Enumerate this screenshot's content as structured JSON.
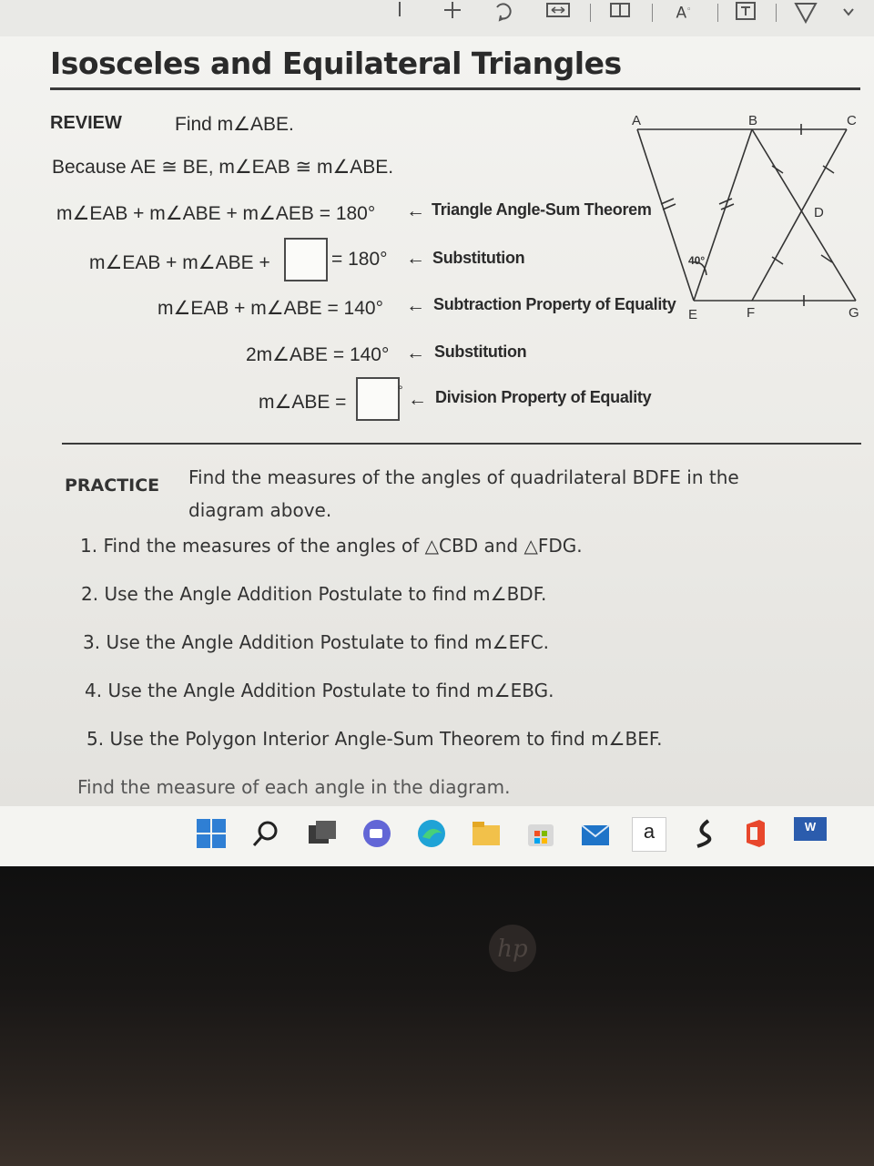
{
  "toolbar": {
    "icons": [
      "minus-icon",
      "plus-icon",
      "rotate-icon",
      "fit-width-icon",
      "immersive-reader-icon",
      "text-size-icon",
      "text-box-icon",
      "draw-icon",
      "chevron-down-icon"
    ],
    "text_size_label": "A"
  },
  "page": {
    "title": "Isosceles and Equilateral Triangles"
  },
  "review": {
    "label": "REVIEW",
    "prompt": "Find m∠ABE.",
    "because": "Because AE ≅ BE, m∠EAB ≅ m∠ABE.",
    "lines": [
      {
        "expr": "m∠EAB + m∠ABE + m∠AEB = 180°",
        "arrow": "←",
        "reason": "Triangle Angle-Sum Theorem"
      },
      {
        "expr_before": "m∠EAB + m∠ABE +",
        "expr_after": "= 180°",
        "arrow": "←",
        "reason": "Substitution"
      },
      {
        "expr": "m∠EAB + m∠ABE = 140°",
        "arrow": "←",
        "reason": "Subtraction Property of Equality"
      },
      {
        "expr": "2m∠ABE = 140°",
        "arrow": "←",
        "reason": "Substitution"
      },
      {
        "expr_before": "m∠ABE =",
        "expr_after": "°",
        "arrow": "←",
        "reason": "Division Property of Equality"
      }
    ],
    "answer_box_1": "",
    "answer_box_2": ""
  },
  "diagram": {
    "points": {
      "A": "A",
      "B": "B",
      "C": "C",
      "D": "D",
      "E": "E",
      "F": "F",
      "G": "G"
    },
    "angle_label": "40°"
  },
  "practice": {
    "label": "PRACTICE",
    "intro_line1": "Find the measures of the angles of quadrilateral BDFE in the",
    "intro_line2": "diagram above.",
    "items": [
      "1. Find the measures of the angles of △CBD and △FDG.",
      "2. Use the Angle Addition Postulate to find m∠BDF.",
      "3. Use the Angle Addition Postulate to find m∠EFC.",
      "4. Use the Angle Addition Postulate to find m∠EBG.",
      "5. Use the Polygon Interior Angle-Sum Theorem to find m∠BEF."
    ],
    "footer": "Find the measure of each angle in the diagram."
  },
  "taskbar": {
    "icons": [
      "windows-start-icon",
      "search-icon",
      "task-view-icon",
      "chat-icon",
      "edge-icon",
      "file-explorer-icon",
      "store-icon",
      "mail-icon",
      "amazon-icon",
      "pen-app-icon",
      "office-icon",
      "word-icon"
    ],
    "amazon_glyph": "a",
    "word_glyph": "W"
  },
  "device": {
    "logo": "hp"
  },
  "colors": {
    "text": "#2b2b2b",
    "screen_bg": "#efeeeb",
    "bezel": "#151210"
  }
}
